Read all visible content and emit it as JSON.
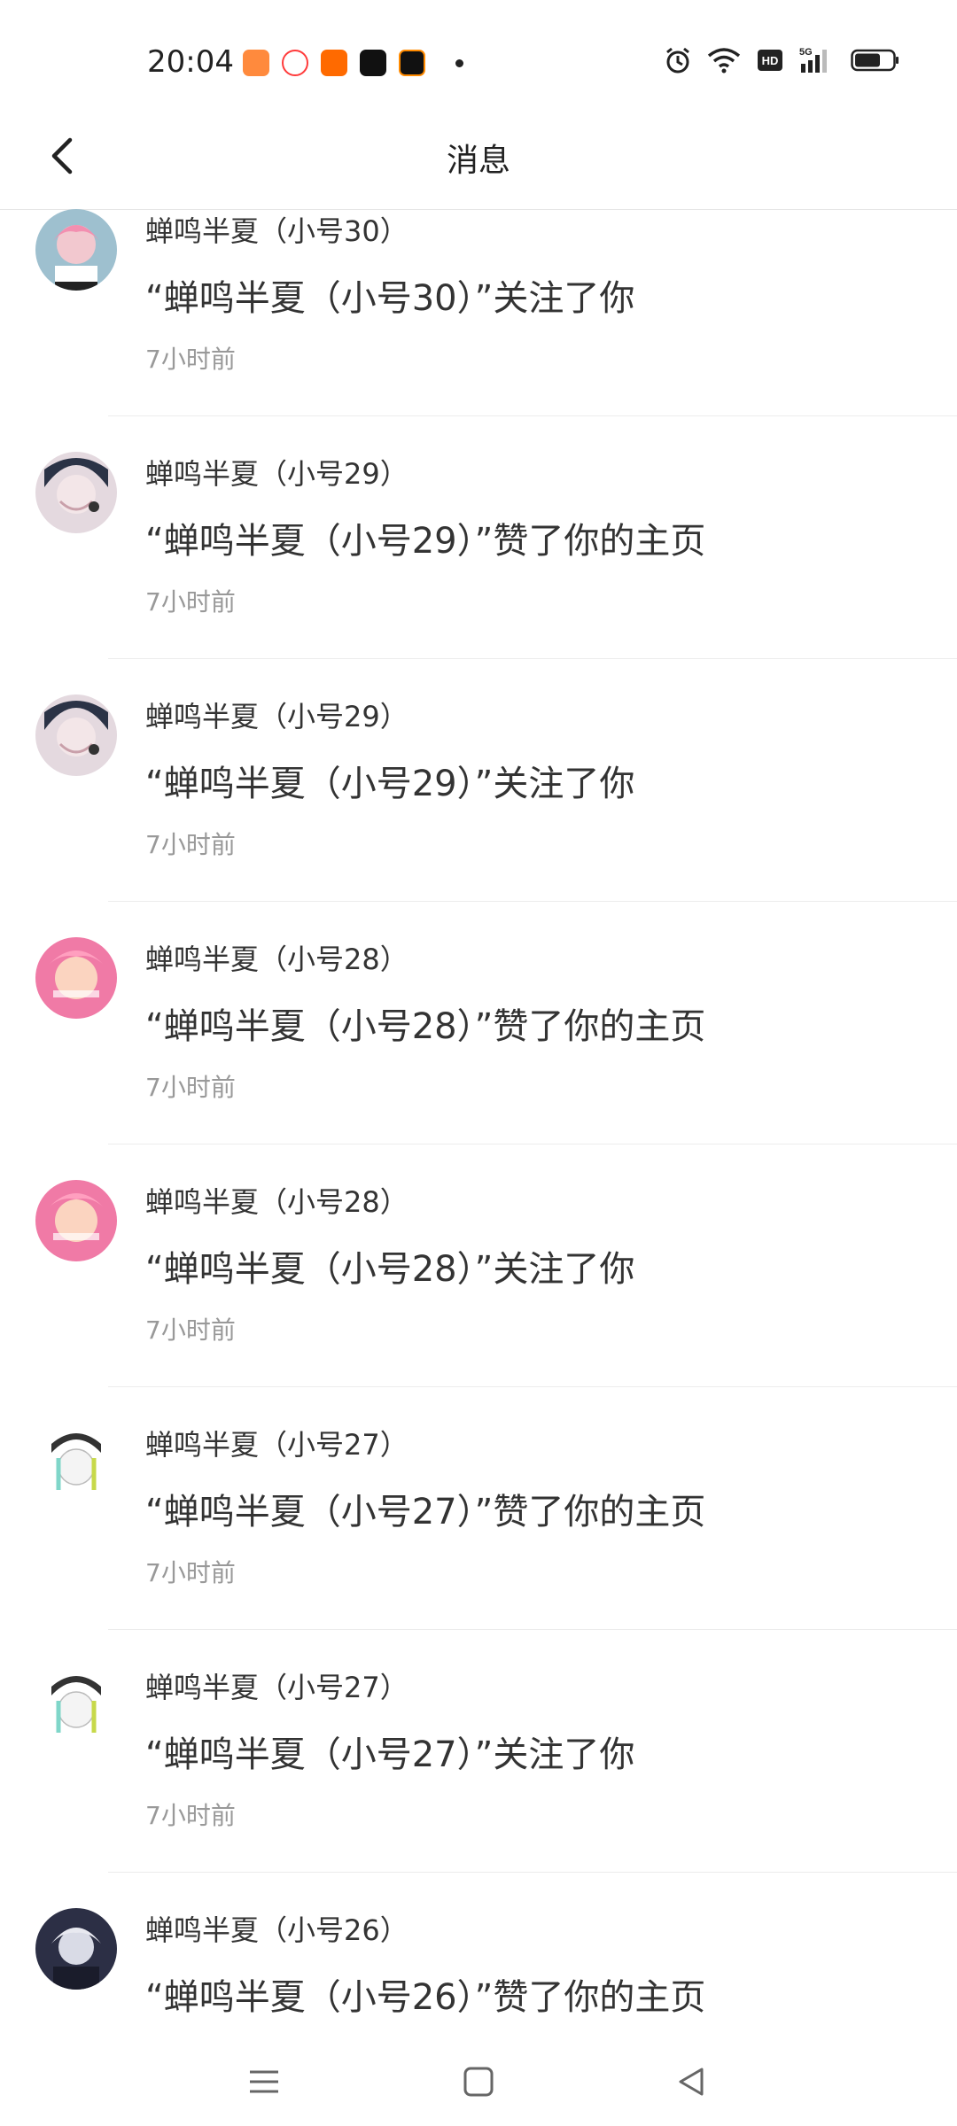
{
  "status_bar": {
    "time": "20:04",
    "app_icons": [
      "game-icon",
      "video-icon",
      "live-icon",
      "tiktok-icon",
      "notes-icon"
    ],
    "right_icons": [
      "alarm-icon",
      "wifi-icon",
      "hd-icon",
      "signal-5g-icon",
      "battery-icon"
    ]
  },
  "header": {
    "title": "消息",
    "back_icon": "chevron-left-icon"
  },
  "messages": [
    {
      "name": "蝉鸣半夏（小号30）",
      "text": "“蝉鸣半夏（小号30）”关注了你",
      "time": "7小时前",
      "avatar_color": "#8fb3c4"
    },
    {
      "name": "蝉鸣半夏（小号29）",
      "text": "“蝉鸣半夏（小号29）”赞了你的主页",
      "time": "7小时前",
      "avatar_color": "#c9b7c2"
    },
    {
      "name": "蝉鸣半夏（小号29）",
      "text": "“蝉鸣半夏（小号29）”关注了你",
      "time": "7小时前",
      "avatar_color": "#c9b7c2"
    },
    {
      "name": "蝉鸣半夏（小号28）",
      "text": "“蝉鸣半夏（小号28）”赞了你的主页",
      "time": "7小时前",
      "avatar_color": "#f07aa6"
    },
    {
      "name": "蝉鸣半夏（小号28）",
      "text": "“蝉鸣半夏（小号28）”关注了你",
      "time": "7小时前",
      "avatar_color": "#f07aa6"
    },
    {
      "name": "蝉鸣半夏（小号27）",
      "text": "“蝉鸣半夏（小号27）”赞了你的主页",
      "time": "7小时前",
      "avatar_color": "#eef0f2"
    },
    {
      "name": "蝉鸣半夏（小号27）",
      "text": "“蝉鸣半夏（小号27）”关注了你",
      "time": "7小时前",
      "avatar_color": "#eef0f2"
    },
    {
      "name": "蝉鸣半夏（小号26）",
      "text": "“蝉鸣半夏（小号26）”赞了你的主页",
      "time": "",
      "avatar_color": "#2c2f45"
    }
  ],
  "nav_bar": {
    "icons": [
      "menu-icon",
      "home-square-icon",
      "back-triangle-icon"
    ]
  }
}
